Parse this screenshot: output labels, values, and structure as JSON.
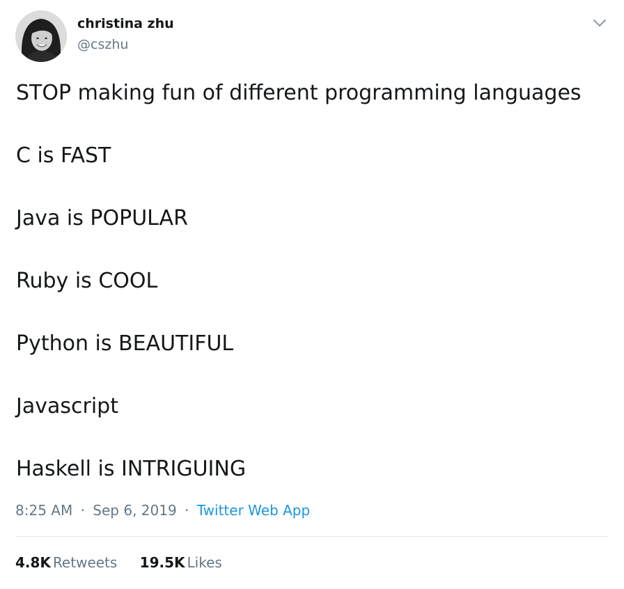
{
  "author": {
    "display_name": "christina zhu",
    "handle": "@cszhu"
  },
  "tweet": {
    "lines": [
      "STOP making fun of different programming languages",
      "C is FAST",
      "Java is POPULAR",
      "Ruby is COOL",
      "Python is BEAUTIFUL",
      "Javascript",
      "Haskell is INTRIGUING"
    ],
    "time": "8:25 AM",
    "separator": "·",
    "date": "Sep 6, 2019",
    "source": "Twitter Web App"
  },
  "stats": {
    "retweets_count": "4.8K",
    "retweets_label": "Retweets",
    "likes_count": "19.5K",
    "likes_label": "Likes"
  },
  "icons": {
    "menu": "chevron-down-icon",
    "avatar": "avatar"
  },
  "colors": {
    "text": "#14171a",
    "secondary": "#657786",
    "link": "#1b95e0",
    "divider": "#e1e8ed"
  }
}
